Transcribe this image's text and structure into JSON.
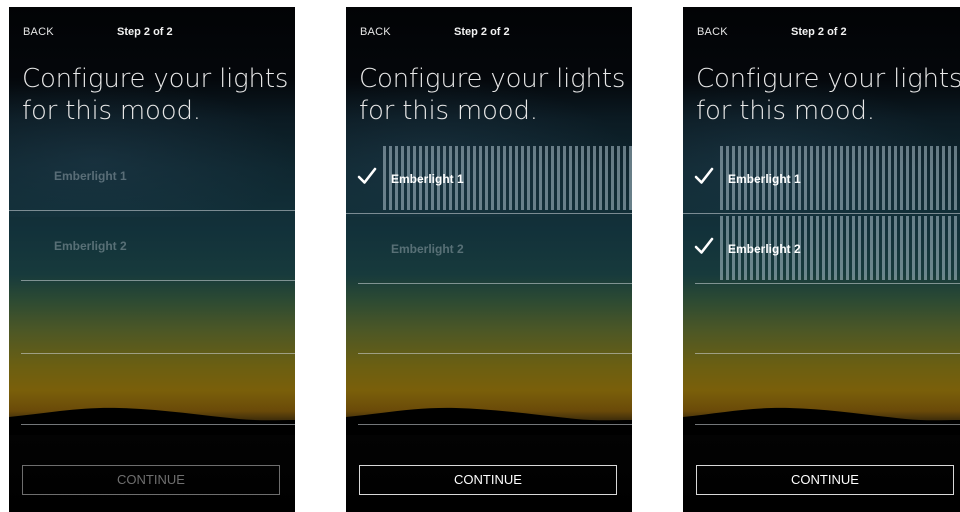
{
  "colors": {
    "background": "#000000",
    "active_text": "#ffffff",
    "disabled_text": "#6f6f6f",
    "selection_bars": "#afc3cd"
  },
  "screens": [
    {
      "back_label": "BACK",
      "step_label": "Step 2 of 2",
      "heading": "Configure your lights for this mood.",
      "lights": [
        {
          "name": "Emberlight 1",
          "selected": false
        },
        {
          "name": "Emberlight 2",
          "selected": false
        }
      ],
      "continue_label": "CONTINUE",
      "continue_enabled": false
    },
    {
      "back_label": "BACK",
      "step_label": "Step 2 of 2",
      "heading": "Configure your lights for this mood.",
      "lights": [
        {
          "name": "Emberlight 1",
          "selected": true
        },
        {
          "name": "Emberlight 2",
          "selected": false
        }
      ],
      "continue_label": "CONTINUE",
      "continue_enabled": true
    },
    {
      "back_label": "BACK",
      "step_label": "Step 2 of 2",
      "heading": "Configure your lights for this mood.",
      "lights": [
        {
          "name": "Emberlight 1",
          "selected": true
        },
        {
          "name": "Emberlight 2",
          "selected": true
        }
      ],
      "continue_label": "CONTINUE",
      "continue_enabled": true
    }
  ]
}
